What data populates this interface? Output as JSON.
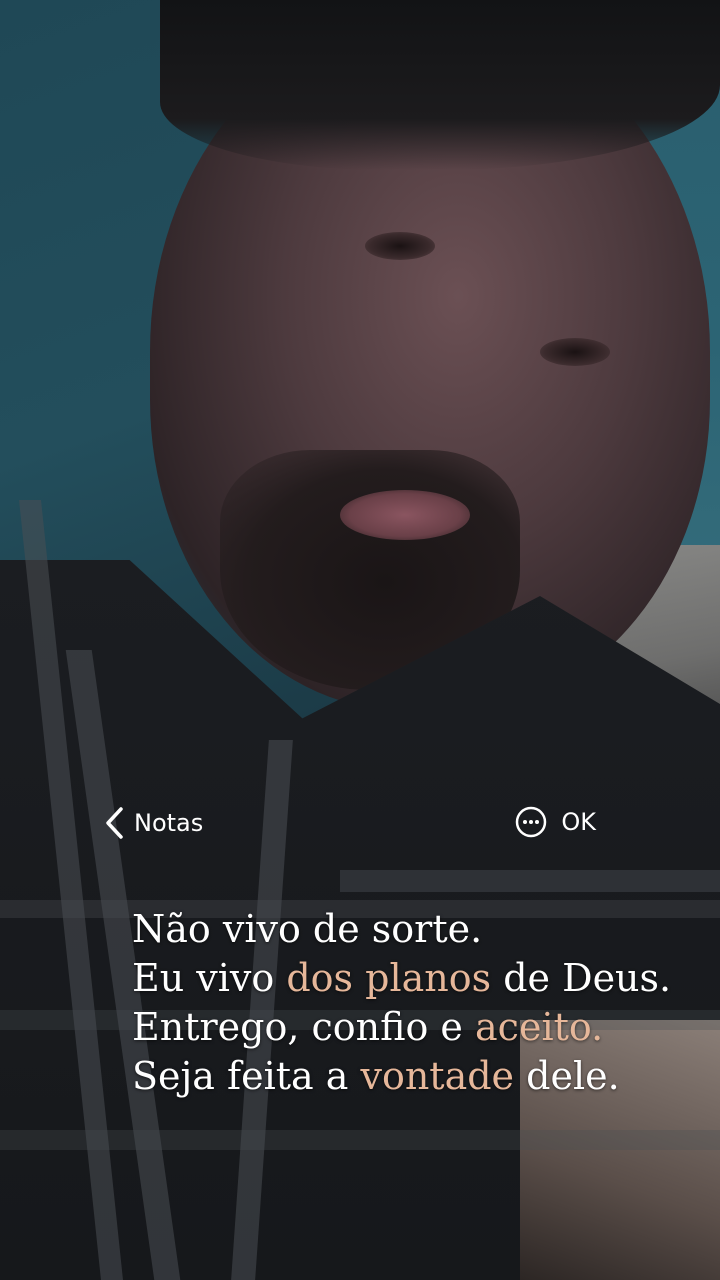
{
  "header": {
    "back_label": "Notas",
    "ok_label": "OK"
  },
  "note": {
    "lines": [
      {
        "parts": [
          {
            "text": "Não vivo de sorte.",
            "highlight": false
          }
        ]
      },
      {
        "parts": [
          {
            "text": "Eu vivo ",
            "highlight": false
          },
          {
            "text": "dos planos",
            "highlight": true
          },
          {
            "text": " de Deus.",
            "highlight": false
          }
        ]
      },
      {
        "parts": [
          {
            "text": "Entrego, confio e ",
            "highlight": false
          },
          {
            "text": "aceito.",
            "highlight": true
          }
        ]
      },
      {
        "parts": [
          {
            "text": "Seja feita a ",
            "highlight": false
          },
          {
            "text": "vontade",
            "highlight": true
          },
          {
            "text": " dele.",
            "highlight": false
          }
        ]
      }
    ]
  },
  "colors": {
    "text": "#ffffff",
    "highlight": "#e6b79a"
  },
  "icons": {
    "back": "chevron-left-icon",
    "more": "more-circle-icon"
  }
}
